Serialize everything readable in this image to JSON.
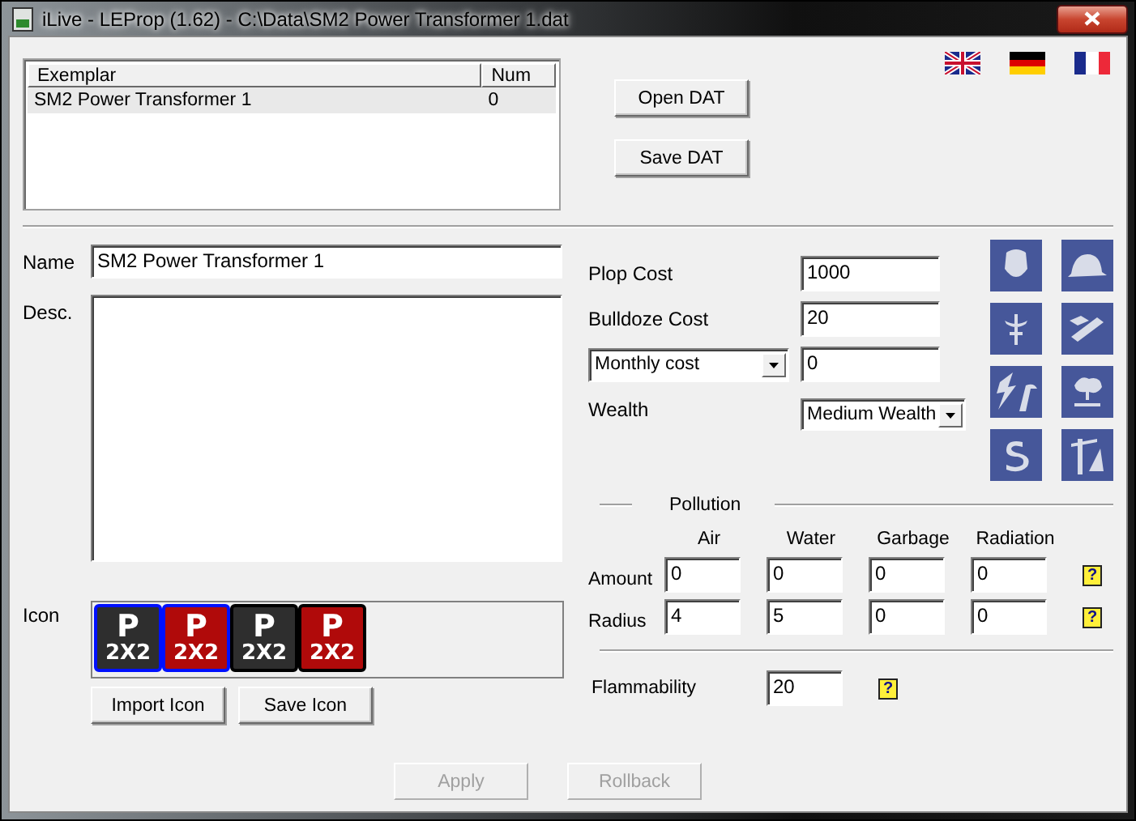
{
  "window": {
    "title": "iLive - LEProp (1.62) - C:\\Data\\SM2 Power Transformer 1.dat"
  },
  "languages": [
    {
      "kind": "uk"
    },
    {
      "kind": "de"
    },
    {
      "kind": "fr"
    }
  ],
  "exemplar_list": {
    "columns": [
      "Exemplar",
      "Num"
    ],
    "rows": [
      {
        "cells": [
          "SM2 Power Transformer 1",
          "0"
        ],
        "selected": true
      }
    ]
  },
  "file_buttons": [
    "Open DAT",
    "Save DAT"
  ],
  "name": {
    "label": "Name",
    "value": "SM2 Power Transformer 1"
  },
  "description": {
    "label": "Desc."
  },
  "icon": {
    "label": "Icon",
    "tiles": [
      {
        "top": "P",
        "bottom": "2X2",
        "color": "#2e2e2e",
        "selected": true
      },
      {
        "top": "P",
        "bottom": "2X2",
        "color": "#b00a0a",
        "selected": true
      },
      {
        "top": "P",
        "bottom": "2X2",
        "color": "#2e2e2e",
        "selected": false
      },
      {
        "top": "P",
        "bottom": "2X2",
        "color": "#b00a0a",
        "selected": false
      }
    ],
    "buttons": [
      "Import Icon",
      "Save Icon"
    ]
  },
  "costs": [
    {
      "kind": "label",
      "label": "Plop Cost",
      "value": "1000"
    },
    {
      "kind": "label",
      "label": "Bulldoze Cost",
      "value": "20"
    },
    {
      "kind": "dropdown",
      "label": "Monthly cost",
      "value": "0"
    }
  ],
  "wealth": {
    "label": "Wealth",
    "value": "Medium Wealth"
  },
  "pollution": {
    "title": "Pollution",
    "columns": [
      "Air",
      "Water",
      "Garbage",
      "Radiation"
    ],
    "rows": [
      {
        "label": "Amount",
        "values": [
          "0",
          "0",
          "0",
          "0"
        ],
        "help": "?"
      },
      {
        "label": "Radius",
        "values": [
          "4",
          "5",
          "0",
          "0"
        ],
        "help": "?"
      }
    ]
  },
  "flammability": {
    "label": "Flammability",
    "value": "20",
    "help": "?"
  },
  "actions": [
    {
      "label": "Apply",
      "disabled": true
    },
    {
      "label": "Rollback",
      "disabled": true
    }
  ]
}
